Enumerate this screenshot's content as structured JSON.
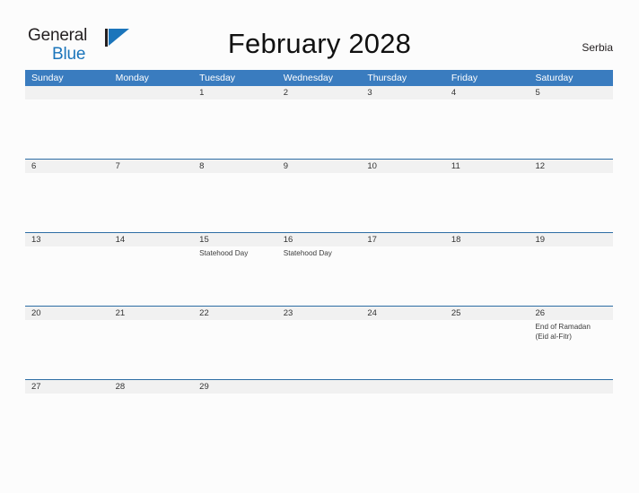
{
  "brand": {
    "line1": "General",
    "line2": "Blue",
    "mark": "triangle-flag-logo"
  },
  "header": {
    "title": "February 2028",
    "region": "Serbia"
  },
  "calendar": {
    "weekdays": [
      "Sunday",
      "Monday",
      "Tuesday",
      "Wednesday",
      "Thursday",
      "Friday",
      "Saturday"
    ],
    "weeks": [
      {
        "days": [
          {
            "num": "",
            "events": []
          },
          {
            "num": "",
            "events": []
          },
          {
            "num": "1",
            "events": []
          },
          {
            "num": "2",
            "events": []
          },
          {
            "num": "3",
            "events": []
          },
          {
            "num": "4",
            "events": []
          },
          {
            "num": "5",
            "events": []
          }
        ]
      },
      {
        "days": [
          {
            "num": "6",
            "events": []
          },
          {
            "num": "7",
            "events": []
          },
          {
            "num": "8",
            "events": []
          },
          {
            "num": "9",
            "events": []
          },
          {
            "num": "10",
            "events": []
          },
          {
            "num": "11",
            "events": []
          },
          {
            "num": "12",
            "events": []
          }
        ]
      },
      {
        "days": [
          {
            "num": "13",
            "events": []
          },
          {
            "num": "14",
            "events": []
          },
          {
            "num": "15",
            "events": [
              "Statehood Day"
            ]
          },
          {
            "num": "16",
            "events": [
              "Statehood Day"
            ]
          },
          {
            "num": "17",
            "events": []
          },
          {
            "num": "18",
            "events": []
          },
          {
            "num": "19",
            "events": []
          }
        ]
      },
      {
        "days": [
          {
            "num": "20",
            "events": []
          },
          {
            "num": "21",
            "events": []
          },
          {
            "num": "22",
            "events": []
          },
          {
            "num": "23",
            "events": []
          },
          {
            "num": "24",
            "events": []
          },
          {
            "num": "25",
            "events": []
          },
          {
            "num": "26",
            "events": [
              "End of Ramadan",
              "(Eid al-Fitr)"
            ]
          }
        ]
      },
      {
        "days": [
          {
            "num": "27",
            "events": []
          },
          {
            "num": "28",
            "events": []
          },
          {
            "num": "29",
            "events": []
          },
          {
            "num": "",
            "events": []
          },
          {
            "num": "",
            "events": []
          },
          {
            "num": "",
            "events": []
          },
          {
            "num": "",
            "events": []
          }
        ]
      }
    ]
  },
  "colors": {
    "header_blue": "#3a7cbf",
    "rule_blue": "#2d6da4",
    "band_gray": "#f1f1f1",
    "brand_blue": "#1b75bb",
    "page_bg": "#fcfcfc"
  }
}
